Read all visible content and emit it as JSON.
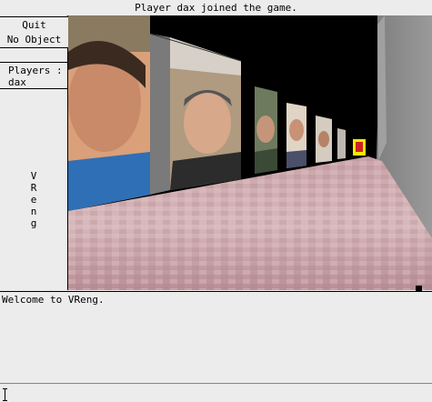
{
  "status_message": "Player dax joined the game.",
  "sidebar": {
    "quit_label": "Quit",
    "object_label": "No Object",
    "players_label": "Players :",
    "players": [
      "dax"
    ],
    "vertical_title_letters": [
      "V",
      "R",
      "e",
      "n",
      "g"
    ]
  },
  "console": {
    "messages": [
      "Welcome to VReng."
    ]
  },
  "input": {
    "value": ""
  },
  "colors": {
    "background": "#ececec",
    "viewport_sky": "#000000",
    "floor_base": "#cfa8ac",
    "wall_grey": "#8c8c8c"
  }
}
